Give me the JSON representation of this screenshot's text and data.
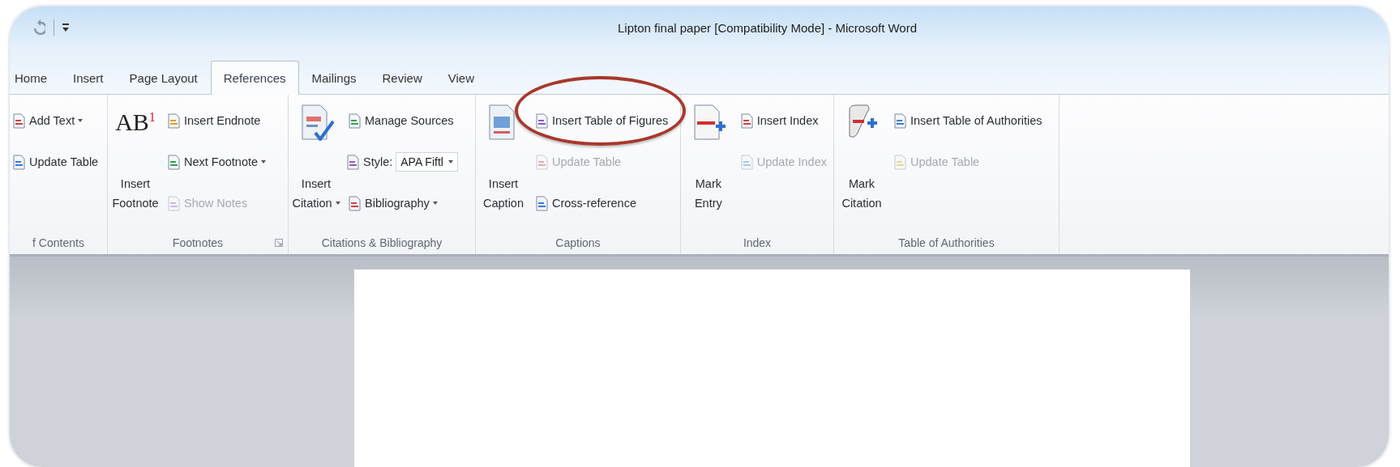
{
  "window": {
    "title": "Lipton final paper [Compatibility Mode]  -  Microsoft Word"
  },
  "tabs": [
    {
      "label": "Home",
      "selected": false
    },
    {
      "label": "Insert",
      "selected": false
    },
    {
      "label": "Page Layout",
      "selected": false
    },
    {
      "label": "References",
      "selected": true
    },
    {
      "label": "Mailings",
      "selected": false
    },
    {
      "label": "Review",
      "selected": false
    },
    {
      "label": "View",
      "selected": false
    }
  ],
  "ribbon_groups": [
    {
      "label": "f Contents",
      "dialog_launcher": false,
      "items": [
        {
          "kind": "small",
          "label": "Add Text",
          "dropdown": true,
          "disabled": false,
          "circled": false
        },
        {
          "kind": "small",
          "label": "Update Table",
          "dropdown": false,
          "disabled": false,
          "circled": false
        }
      ]
    },
    {
      "label": "Footnotes",
      "dialog_launcher": true,
      "items": [
        {
          "kind": "large",
          "glyph": "AB$^{1}$",
          "lines": [
            "Insert",
            "Footnote"
          ],
          "dropdown": false,
          "disabled": false,
          "circled": false
        },
        {
          "kind": "small",
          "label": "Insert Endnote",
          "dropdown": false,
          "disabled": false,
          "circled": false
        },
        {
          "kind": "small",
          "label": "Next Footnote",
          "dropdown": true,
          "disabled": false,
          "circled": false
        },
        {
          "kind": "small",
          "label": "Show Notes",
          "dropdown": false,
          "disabled": true,
          "circled": false
        }
      ]
    },
    {
      "label": "Citations & Bibliography",
      "dialog_launcher": false,
      "items": [
        {
          "kind": "large",
          "lines": [
            "Insert",
            "Citation"
          ],
          "dropdown": true,
          "disabled": false,
          "circled": false
        },
        {
          "kind": "small",
          "label": "Manage Sources",
          "dropdown": false,
          "disabled": false,
          "circled": false
        },
        {
          "kind": "combo",
          "label": "Style:",
          "value": "APA Fiftl",
          "dropdown": true,
          "disabled": false,
          "circled": false
        },
        {
          "kind": "small",
          "label": "Bibliography",
          "dropdown": true,
          "disabled": false,
          "circled": false
        }
      ]
    },
    {
      "label": "Captions",
      "dialog_launcher": false,
      "items": [
        {
          "kind": "large",
          "lines": [
            "Insert",
            "Caption"
          ],
          "dropdown": false,
          "disabled": false,
          "circled": false
        },
        {
          "kind": "small",
          "label": "Insert Table of Figures",
          "dropdown": false,
          "disabled": false,
          "circled": true
        },
        {
          "kind": "small",
          "label": "Update Table",
          "dropdown": false,
          "disabled": true,
          "circled": false
        },
        {
          "kind": "small",
          "label": "Cross-reference",
          "dropdown": false,
          "disabled": false,
          "circled": false
        }
      ]
    },
    {
      "label": "Index",
      "dialog_launcher": false,
      "items": [
        {
          "kind": "large",
          "lines": [
            "Mark",
            "Entry"
          ],
          "dropdown": false,
          "disabled": false,
          "circled": false
        },
        {
          "kind": "small",
          "label": "Insert Index",
          "dropdown": false,
          "disabled": false,
          "circled": false
        },
        {
          "kind": "small",
          "label": "Update Index",
          "dropdown": false,
          "disabled": true,
          "circled": false
        }
      ]
    },
    {
      "label": "Table of Authorities",
      "dialog_launcher": false,
      "items": [
        {
          "kind": "large",
          "lines": [
            "Mark",
            "Citation"
          ],
          "dropdown": false,
          "disabled": false,
          "circled": false
        },
        {
          "kind": "small",
          "label": "Insert Table of Authorities",
          "dropdown": false,
          "disabled": false,
          "circled": false
        },
        {
          "kind": "small",
          "label": "Update Table",
          "dropdown": false,
          "disabled": true,
          "circled": false
        }
      ]
    }
  ]
}
